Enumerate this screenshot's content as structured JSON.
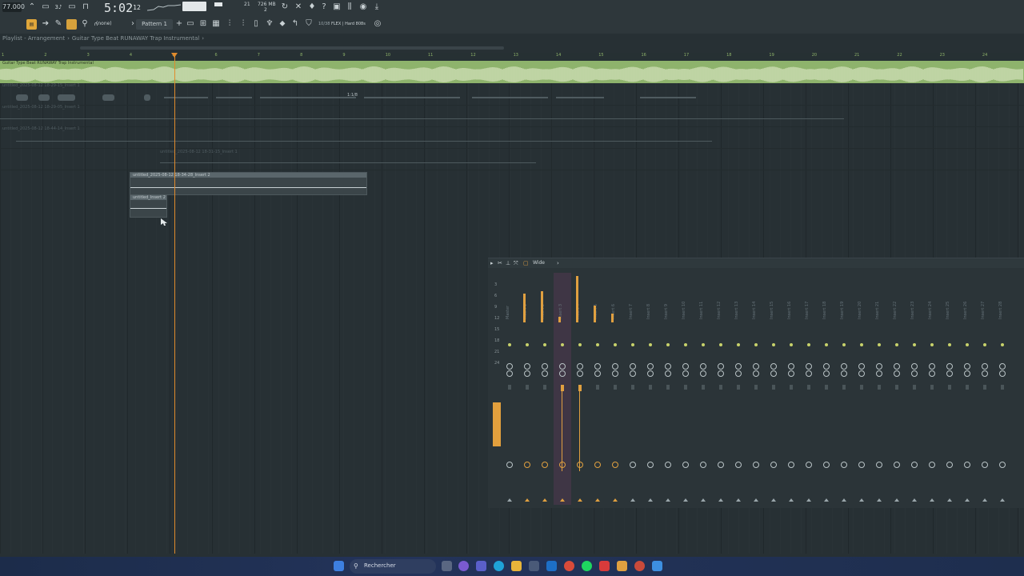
{
  "toolbar": {
    "tempo": "77.000",
    "clock_main": "5:02",
    "clock_sub": "12",
    "cpu_value": "21",
    "memory_top": "726 MB",
    "memory_bottom": "2",
    "snap_label": "(none)",
    "pattern_label": "Pattern 1",
    "flex_label": "FLEX | Hard 808s",
    "flex_prefix": "10/38"
  },
  "breadcrumb": {
    "window": "Playlist - Arrangement",
    "separator": "›",
    "project": "Guitar Type Beat RUNAWAY Trap Instrumental",
    "end": "›"
  },
  "ruler": {
    "bars": [
      "1",
      "2",
      "3",
      "4",
      "5",
      "6",
      "7",
      "8",
      "9",
      "10",
      "11",
      "12",
      "13",
      "14",
      "15",
      "16",
      "17",
      "18",
      "19",
      "20",
      "21",
      "22",
      "23",
      "24"
    ]
  },
  "tracks": {
    "main_clip_title": "Guitar Type Beat RUNAWAY Trap Instrumental",
    "ghost1": "untitled_2025-08-12 18-29-15_Insert 1",
    "ghost2": "untitled_2025-08-12 18-29-05_Insert 1",
    "ghost3": "untitled_2025-08-12 18-44-14_Insert 1",
    "ghost4": "untitled_2025-08-12 18-31-15_Insert 1",
    "ghost_mark": "1:1/8",
    "clip1_title": "untitled_2025-08-12 18-34-28_Insert 2",
    "clip2_title": "untitled_Insert 2"
  },
  "mixer": {
    "title": "Wide",
    "scale": [
      "3",
      "6",
      "9",
      "12",
      "15",
      "18",
      "21",
      "24"
    ],
    "strips": [
      "Master",
      "Insert 1",
      "Insert 2",
      "Insert 3",
      "Insert 4",
      "Insert 5",
      "Insert 6",
      "Insert 7",
      "Insert 8",
      "Insert 9",
      "Insert 10",
      "Insert 11",
      "Insert 12",
      "Insert 13",
      "Insert 14",
      "Insert 15",
      "Insert 16",
      "Insert 17",
      "Insert 18",
      "Insert 19",
      "Insert 20",
      "Insert 21",
      "Insert 22",
      "Insert 23",
      "Insert 24",
      "Insert 25",
      "Insert 26",
      "Insert 27",
      "Insert 28"
    ],
    "colors": {
      "meter": "#e0a040",
      "accent": "#e08b2d",
      "selected": "#7a3a6a"
    }
  },
  "taskbar": {
    "search_label": "Rechercher",
    "icons": [
      "windows-start-icon",
      "search-icon",
      "task-view-icon",
      "copilot-icon",
      "teams-icon",
      "edge-icon",
      "file-explorer-icon",
      "store-icon",
      "outlook-icon",
      "chrome-icon",
      "spotify-icon",
      "office-icon",
      "fl-studio-icon",
      "chrome-dev-icon",
      "notepad-icon"
    ]
  }
}
